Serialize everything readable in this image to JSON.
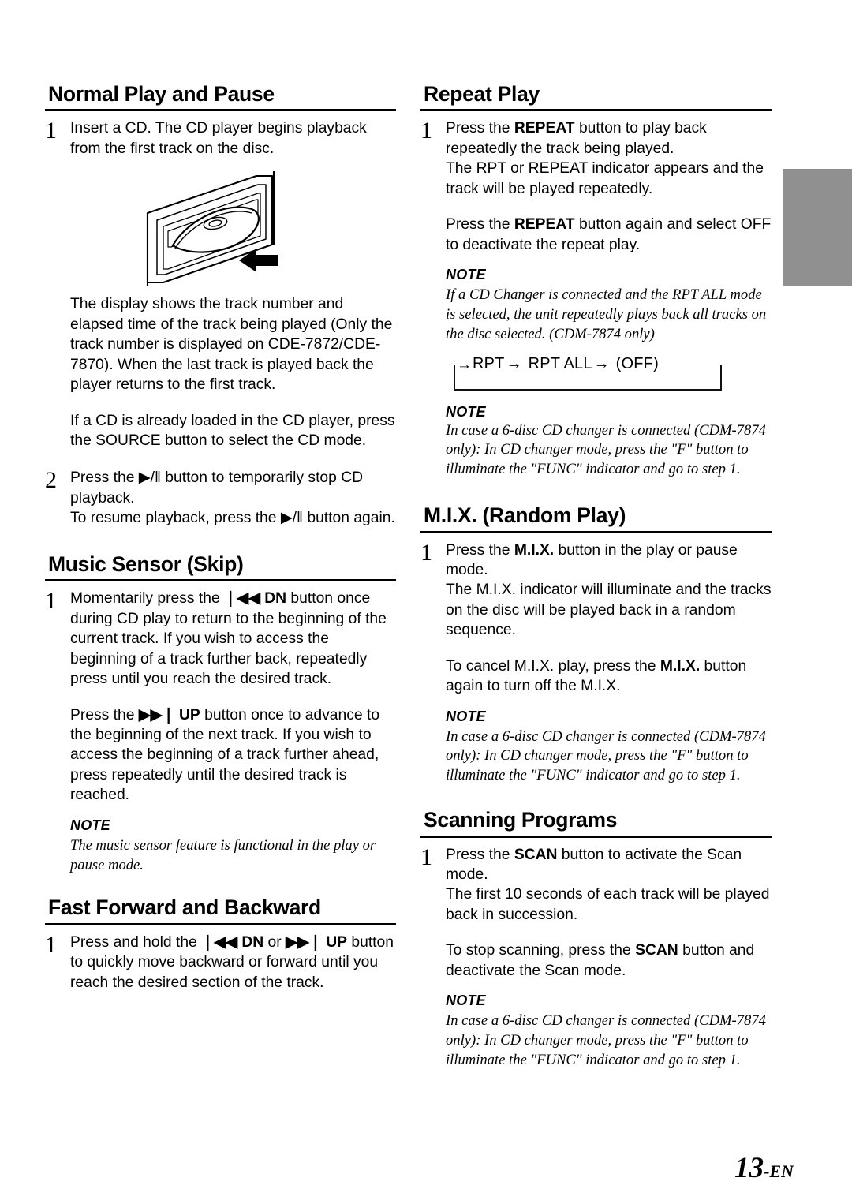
{
  "page": {
    "number": "13",
    "number_suffix": "-EN"
  },
  "edge_tab": {
    "color": "#909090"
  },
  "left_column": {
    "sections": [
      {
        "title": "Normal Play and Pause",
        "step_number": "1",
        "paragraphs": [
          "Insert a CD. The CD player begins playback from the first track on the disc."
        ],
        "figure": "cd-insert-illustration",
        "after_figure_paragraphs": [
          "The display shows the track number and elapsed time of the track being played (Only the track number is displayed on CDE-7872/CDE-7870). When the last track is played back the player returns to the first track.",
          "If a CD is already loaded in the CD player, press the SOURCE button to select the CD mode."
        ],
        "step2_number": "2",
        "step2_paragraphs": [
          "Press the ▶/‖ button to temporarily stop CD playback.",
          "To resume playback, press the ▶/‖ button again."
        ]
      },
      {
        "title": "Music Sensor (Skip)",
        "step_number": "1",
        "paragraph_1_pre": "Momentarily press the ",
        "paragraph_1_btn": "❘◀◀ DN",
        "paragraph_1_post": " button once during CD play to return to the beginning of the current track. If you wish to access the beginning of a track further back, repeatedly press until you reach the desired track.",
        "paragraph_2_pre": "Press the ",
        "paragraph_2_btn": "▶▶❘ UP",
        "paragraph_2_post": " button once to advance to the beginning of the next track. If you wish to access the beginning of a track further ahead, press repeatedly until the desired track is reached.",
        "note_title": "NOTE",
        "note_body": "The music sensor feature is functional in the play or pause mode."
      },
      {
        "title": "Fast Forward and Backward",
        "step_number": "1",
        "paragraph_pre": "Press and hold the ",
        "paragraph_btn_1": "❘◀◀ DN",
        "paragraph_mid": " or ",
        "paragraph_btn_2": "▶▶❘ UP",
        "paragraph_post": " button to quickly move backward or forward until you reach the desired section of the track."
      }
    ]
  },
  "right_column": {
    "sections": [
      {
        "title": "Repeat Play",
        "step_number": "1",
        "paragraph_1_pre": "Press the ",
        "paragraph_1_btn": "REPEAT",
        "paragraph_1_post": " button to play back repeatedly the track being played.",
        "paragraph_1_line2": "The RPT or REPEAT indicator appears and the track will be played repeatedly.",
        "paragraph_2_pre": "Press the ",
        "paragraph_2_btn": "REPEAT",
        "paragraph_2_post": " button again and select OFF to deactivate the repeat play.",
        "note_title": "NOTE",
        "note_body": "If a CD Changer is connected and the RPT ALL mode is selected, the unit repeatedly plays back all tracks on the disc selected. (CDM-7874 only)",
        "cycle": {
          "items": [
            "RPT",
            "RPT ALL",
            "(OFF)"
          ],
          "arrow": "→"
        },
        "note2_title": "NOTE",
        "note2_body": "In case a 6-disc CD changer is connected (CDM-7874 only): In CD changer mode, press the \"F\" button to illuminate the \"FUNC\" indicator and go to step 1."
      },
      {
        "title": "M.I.X. (Random Play)",
        "step_number": "1",
        "paragraph_1_pre": "Press the ",
        "paragraph_1_btn": "M.I.X.",
        "paragraph_1_post": " button in the play or pause mode.",
        "paragraph_1_line2": "The M.I.X. indicator will illuminate and the tracks on the disc will be played back in a random sequence.",
        "paragraph_2_pre": "To cancel M.I.X. play, press the ",
        "paragraph_2_btn": "M.I.X.",
        "paragraph_2_post": " button again to turn off the M.I.X.",
        "note_title": "NOTE",
        "note_body": "In case a 6-disc CD changer is connected (CDM-7874 only): In CD changer mode, press the \"F\" button to illuminate the \"FUNC\" indicator and go to step 1."
      },
      {
        "title": "Scanning Programs",
        "step_number": "1",
        "paragraph_1_pre": "Press the ",
        "paragraph_1_btn": "SCAN",
        "paragraph_1_post": " button to activate the Scan mode.",
        "paragraph_1_line2": "The first 10 seconds of each track will be played back in succession.",
        "paragraph_2_pre": "To stop scanning, press the ",
        "paragraph_2_btn": "SCAN",
        "paragraph_2_post": " button and deactivate the Scan mode.",
        "note_title": "NOTE",
        "note_body": "In case a 6-disc CD changer is connected (CDM-7874 only): In CD changer mode, press the \"F\" button to illuminate the \"FUNC\" indicator and go to step 1."
      }
    ]
  }
}
